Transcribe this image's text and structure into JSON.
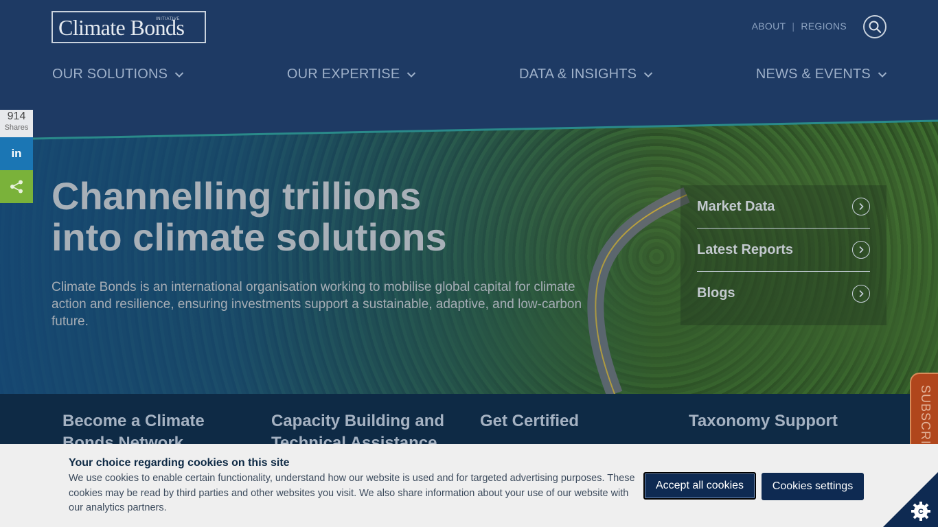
{
  "header": {
    "logo_text": "Climate Bonds",
    "logo_sub": "INITIATIVE",
    "top_links": [
      "ABOUT",
      "REGIONS"
    ],
    "nav": [
      "OUR SOLUTIONS",
      "OUR EXPERTISE",
      "DATA & INSIGHTS",
      "NEWS & EVENTS"
    ]
  },
  "share": {
    "count": "914",
    "label": "Shares",
    "linkedin": "in"
  },
  "hero": {
    "title_line1": "Channelling trillions",
    "title_line2": "into climate solutions",
    "description": "Climate Bonds is an international organisation working to mobilise global capital for climate action and resilience, ensuring investments support a sustainable, adaptive, and low-carbon future.",
    "quick_links": [
      "Market Data",
      "Latest Reports",
      "Blogs"
    ]
  },
  "services": [
    "Become a Climate Bonds Network",
    "Capacity Building and Technical Assistance",
    "Get Certified",
    "Taxonomy Support"
  ],
  "subscribe_label": "SUBSCRIBE",
  "cookie": {
    "title": "Your choice regarding cookies on this site",
    "text": "We use cookies to enable certain functionality, understand how our website is used and for targeted advertising purposes. These cookies may be read by third parties and other websites you visit. We also share information about your use of our website with our analytics partners.",
    "accept_label": "Accept all cookies",
    "settings_label": "Cookies settings"
  },
  "colors": {
    "header_bg": "#1e3a64",
    "strip_bg": "#0e2a45",
    "button_bg": "#0e2a52",
    "subscribe_bg": "#b0461c",
    "linkedin": "#1b76b4",
    "share_green": "#7ab23a"
  }
}
